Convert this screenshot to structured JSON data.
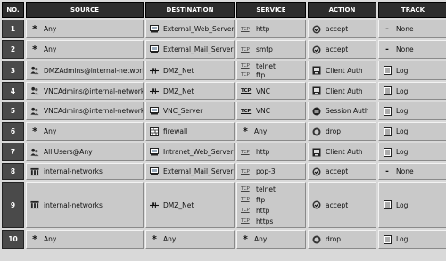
{
  "headers": [
    "NO.",
    "SOURCE",
    "DESTINATION",
    "SERVICE",
    "ACTION",
    "TRACK"
  ],
  "rows": [
    {
      "no": "1",
      "source": {
        "icon": "any-star-icon",
        "text": "Any"
      },
      "destination": {
        "icon": "host-icon",
        "text": "External_Web_Server"
      },
      "services": [
        {
          "proto": "TCP",
          "name": "http"
        }
      ],
      "action": {
        "icon": "accept-icon",
        "text": "accept"
      },
      "track": {
        "icon": "none-dash-icon",
        "text": "None"
      }
    },
    {
      "no": "2",
      "source": {
        "icon": "any-star-icon",
        "text": "Any"
      },
      "destination": {
        "icon": "host-icon",
        "text": "External_Mail_Server"
      },
      "services": [
        {
          "proto": "TCP",
          "name": "smtp"
        }
      ],
      "action": {
        "icon": "accept-icon",
        "text": "accept"
      },
      "track": {
        "icon": "none-dash-icon",
        "text": "None"
      }
    },
    {
      "no": "3",
      "source": {
        "icon": "user-group-icon",
        "text": "DMZAdmins@internal-networks"
      },
      "destination": {
        "icon": "network-icon",
        "text": "DMZ_Net"
      },
      "services": [
        {
          "proto": "TCP",
          "name": "telnet"
        },
        {
          "proto": "TCP",
          "name": "ftp"
        }
      ],
      "action": {
        "icon": "client-auth-icon",
        "text": "Client Auth"
      },
      "track": {
        "icon": "log-icon",
        "text": "Log"
      }
    },
    {
      "no": "4",
      "source": {
        "icon": "user-group-icon",
        "text": "VNCAdmins@internal-networks"
      },
      "destination": {
        "icon": "network-icon",
        "text": "DMZ_Net"
      },
      "services": [
        {
          "proto": "TCP",
          "name": "VNC"
        }
      ],
      "action": {
        "icon": "client-auth-icon",
        "text": "Client Auth"
      },
      "track": {
        "icon": "log-icon",
        "text": "Log"
      }
    },
    {
      "no": "5",
      "source": {
        "icon": "user-group-icon",
        "text": "VNCAdmins@internal-networks"
      },
      "destination": {
        "icon": "host-icon",
        "text": "VNC_Server"
      },
      "services": [
        {
          "proto": "TCP",
          "name": "VNC"
        }
      ],
      "action": {
        "icon": "session-auth-icon",
        "text": "Session Auth"
      },
      "track": {
        "icon": "log-icon",
        "text": "Log"
      }
    },
    {
      "no": "6",
      "source": {
        "icon": "any-star-icon",
        "text": "Any"
      },
      "destination": {
        "icon": "firewall-icon",
        "text": "firewall"
      },
      "services": [
        {
          "proto": "*",
          "name": "Any"
        }
      ],
      "action": {
        "icon": "drop-icon",
        "text": "drop"
      },
      "track": {
        "icon": "log-icon",
        "text": "Log"
      }
    },
    {
      "no": "7",
      "source": {
        "icon": "user-group-icon",
        "text": "All Users@Any"
      },
      "destination": {
        "icon": "host-icon",
        "text": "Intranet_Web_Server"
      },
      "services": [
        {
          "proto": "TCP",
          "name": "http"
        }
      ],
      "action": {
        "icon": "client-auth-icon",
        "text": "Client Auth"
      },
      "track": {
        "icon": "log-icon",
        "text": "Log"
      }
    },
    {
      "no": "8",
      "source": {
        "icon": "group-icon",
        "text": "internal-networks"
      },
      "destination": {
        "icon": "host-icon",
        "text": "External_Mail_Server"
      },
      "services": [
        {
          "proto": "TCP",
          "name": "pop-3"
        }
      ],
      "action": {
        "icon": "accept-icon",
        "text": "accept"
      },
      "track": {
        "icon": "none-dash-icon",
        "text": "None"
      }
    },
    {
      "no": "9",
      "source": {
        "icon": "group-icon",
        "text": "internal-networks"
      },
      "destination": {
        "icon": "network-icon",
        "text": "DMZ_Net"
      },
      "services": [
        {
          "proto": "TCP",
          "name": "telnet"
        },
        {
          "proto": "TCP",
          "name": "ftp"
        },
        {
          "proto": "TCP",
          "name": "http"
        },
        {
          "proto": "TCP",
          "name": "https"
        }
      ],
      "action": {
        "icon": "accept-icon",
        "text": "accept"
      },
      "track": {
        "icon": "log-icon",
        "text": "Log"
      }
    },
    {
      "no": "10",
      "source": {
        "icon": "any-star-icon",
        "text": "Any"
      },
      "destination": {
        "icon": "any-star-icon",
        "text": "Any"
      },
      "services": [
        {
          "proto": "*",
          "name": "Any"
        }
      ],
      "action": {
        "icon": "drop-icon",
        "text": "drop"
      },
      "track": {
        "icon": "log-icon",
        "text": "Log"
      }
    }
  ]
}
